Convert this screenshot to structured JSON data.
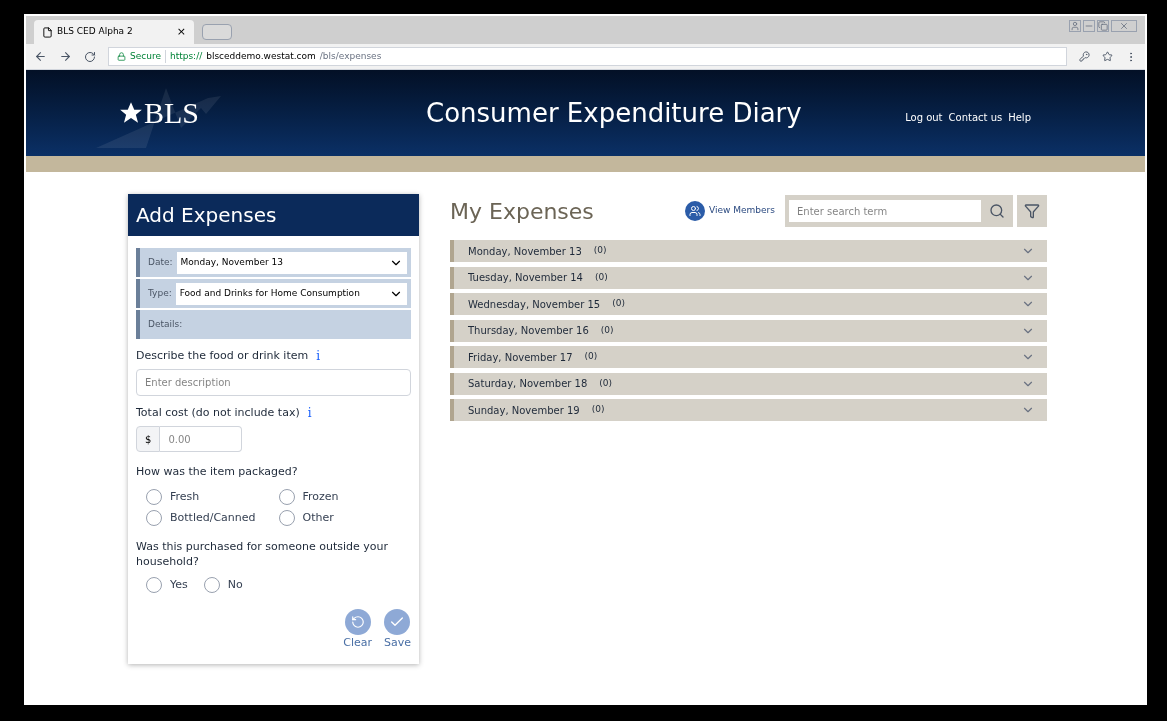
{
  "browser": {
    "tab_title": "BLS CED Alpha 2",
    "tab_close": "×",
    "secure_label": "Secure",
    "url_scheme": "https://",
    "url_host": "blsceddemo.westat.com",
    "url_path": "/bls/expenses"
  },
  "header": {
    "logo": "BLS",
    "title": "Consumer Expenditure Diary",
    "links": [
      "Log out",
      "Contact us",
      "Help"
    ]
  },
  "add_panel": {
    "title": "Add Expenses",
    "selects": [
      {
        "label": "Date:",
        "value": "Monday, November 13"
      },
      {
        "label": "Type:",
        "value": "Food and Drinks for Home Consumption"
      }
    ],
    "details_label": "Details:",
    "description": {
      "label": "Describe the food or drink item",
      "info": "i",
      "placeholder": "Enter description"
    },
    "cost": {
      "label": "Total cost (do not include tax)",
      "info": "i",
      "prefix": "$",
      "placeholder": "0.00"
    },
    "packaging": {
      "question": "How was the item packaged?",
      "options": [
        {
          "label": "Fresh",
          "selected": false
        },
        {
          "label": "Frozen",
          "selected": false
        },
        {
          "label": "Bottled/Canned",
          "selected": false
        },
        {
          "label": "Other",
          "selected": false
        }
      ]
    },
    "outside": {
      "question": "Was this purchased for someone outside your household?",
      "options": [
        {
          "label": "Yes",
          "selected": false
        },
        {
          "label": "No",
          "selected": false
        }
      ]
    },
    "buttons": [
      {
        "kind": "clear",
        "label": "Clear"
      },
      {
        "kind": "save",
        "label": "Save"
      }
    ]
  },
  "expenses": {
    "title": "My Expenses",
    "view_members": "View Members",
    "search_placeholder": "Enter search term",
    "days": [
      {
        "label": "Monday, November 13",
        "count": "(0)",
        "expanded": false
      },
      {
        "label": "Tuesday, November 14",
        "count": "(0)",
        "expanded": false
      },
      {
        "label": "Wednesday, November 15",
        "count": "(0)",
        "expanded": false
      },
      {
        "label": "Thursday, November 16",
        "count": "(0)",
        "expanded": false
      },
      {
        "label": "Friday, November 17",
        "count": "(0)",
        "expanded": false
      },
      {
        "label": "Saturday, November 18",
        "count": "(0)",
        "expanded": false
      },
      {
        "label": "Sunday, November 19",
        "count": "(0)",
        "expanded": false
      }
    ]
  }
}
